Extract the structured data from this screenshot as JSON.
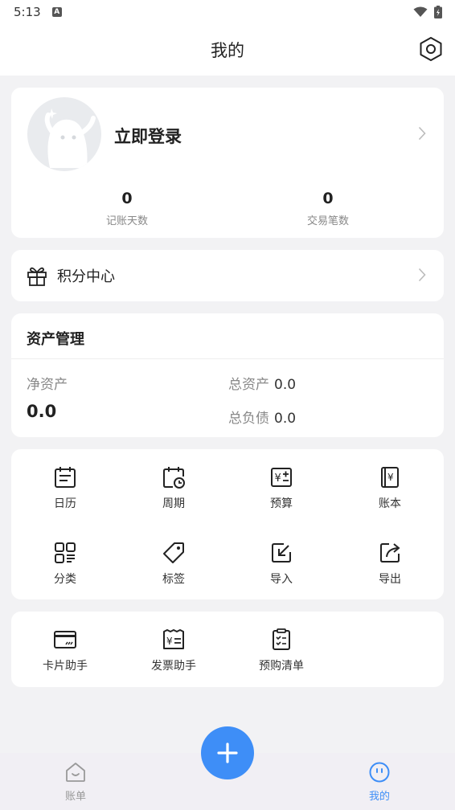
{
  "status_bar": {
    "time": "5:13",
    "badge": "A"
  },
  "header": {
    "title": "我的"
  },
  "profile": {
    "login_label": "立即登录",
    "stats": [
      {
        "value": "0",
        "label": "记账天数"
      },
      {
        "value": "0",
        "label": "交易笔数"
      }
    ]
  },
  "points": {
    "label": "积分中心"
  },
  "assets": {
    "title": "资产管理",
    "net_label": "净资产",
    "net_value": "0.0",
    "total_label": "总资产",
    "total_value": "0.0",
    "debt_label": "总负债",
    "debt_value": "0.0"
  },
  "tools": [
    {
      "label": "日历",
      "icon": "calendar-icon"
    },
    {
      "label": "周期",
      "icon": "cycle-icon"
    },
    {
      "label": "预算",
      "icon": "budget-icon"
    },
    {
      "label": "账本",
      "icon": "ledger-icon"
    },
    {
      "label": "分类",
      "icon": "category-icon"
    },
    {
      "label": "标签",
      "icon": "tag-icon"
    },
    {
      "label": "导入",
      "icon": "import-icon"
    },
    {
      "label": "导出",
      "icon": "export-icon"
    }
  ],
  "helpers": [
    {
      "label": "卡片助手",
      "icon": "card-icon"
    },
    {
      "label": "发票助手",
      "icon": "invoice-icon"
    },
    {
      "label": "预购清单",
      "icon": "checklist-icon"
    }
  ],
  "tabbar": {
    "bills": "账单",
    "mine": "我的"
  },
  "colors": {
    "accent": "#3e8ef7",
    "background": "#f2f2f4",
    "muted": "#888888"
  }
}
